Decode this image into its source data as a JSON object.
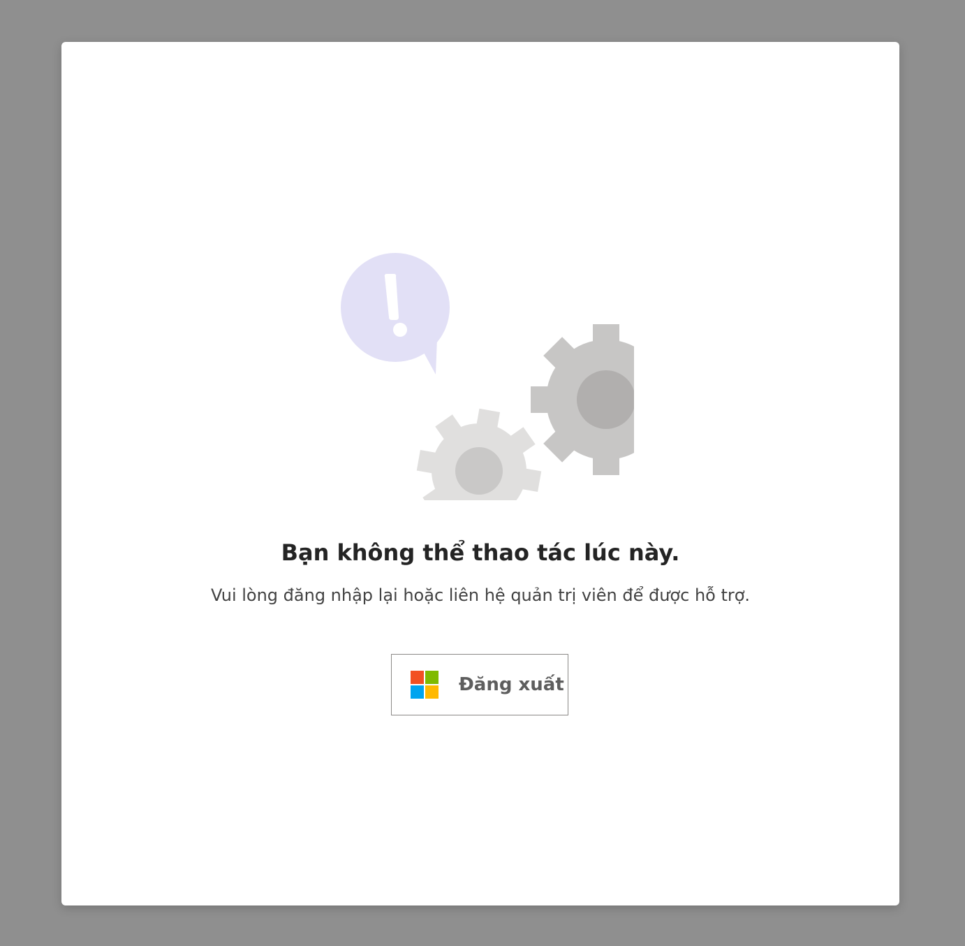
{
  "dialog": {
    "title": "Bạn không thể thao tác lúc này.",
    "message": "Vui lòng đăng nhập lại hoặc liên hệ quản trị viên để được hỗ trợ.",
    "signout_label": "Đăng xuất"
  },
  "icons": {
    "illustration": "gears-with-alert-bubble-icon",
    "button": "microsoft-logo-icon"
  },
  "colors": {
    "backdrop": "#8f8f8f",
    "bubble": "#e2e0f6",
    "gear_large": "#c7c6c5",
    "gear_large_hub": "#b1afae",
    "gear_small": "#e0dfde",
    "gear_small_hub": "#c9c8c7",
    "ms_red": "#f25022",
    "ms_green": "#7fba00",
    "ms_blue": "#00a4ef",
    "ms_yellow": "#ffb900"
  }
}
